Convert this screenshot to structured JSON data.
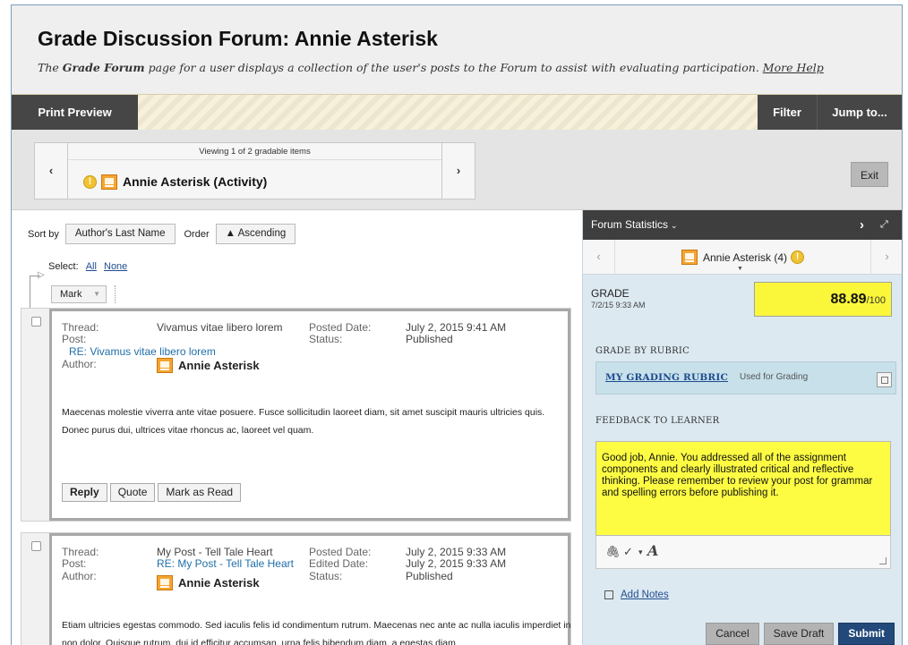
{
  "page": {
    "title": "Grade Discussion Forum: Annie Asterisk",
    "desc_pre": "The ",
    "desc_bold": "Grade Forum",
    "desc_post": " page for a user displays a collection of the user's posts to the Forum to assist with evaluating participation.",
    "more_help": "More Help"
  },
  "toolbar": {
    "print_preview": "Print Preview",
    "filter": "Filter",
    "jump_to": "Jump to..."
  },
  "pager": {
    "prev": "‹",
    "next": "›",
    "viewing": "Viewing 1 of 2 gradable items",
    "item_title": "Annie Asterisk (Activity)",
    "warn": "!",
    "exit": "Exit"
  },
  "sort": {
    "sort_by_label": "Sort by",
    "sort_by_value": "Author's Last Name",
    "order_label": "Order",
    "order_value": "▲ Ascending"
  },
  "select": {
    "label": "Select:",
    "all": "All",
    "none": "None",
    "mark": "Mark"
  },
  "posts": [
    {
      "thread_label": "Thread:",
      "thread_value": "Vivamus vitae libero lorem",
      "post_label": "Post:",
      "post_link": "RE: Vivamus vitae libero lorem",
      "author_label": "Author:",
      "author": "Annie Asterisk",
      "date1_label": "Posted Date:",
      "date1_value": "July 2, 2015 9:41 AM",
      "date2_label": "Status:",
      "date2_value": "Published",
      "body": "Maecenas molestie viverra ante vitae posuere. Fusce sollicitudin laoreet diam, sit amet suscipit mauris ultricies quis. Donec purus dui, ultrices vitae rhoncus ac, laoreet vel quam.",
      "reply": "Reply",
      "quote": "Quote",
      "mark_read": "Mark as Read"
    },
    {
      "thread_label": "Thread:",
      "thread_value": "My Post - Tell Tale Heart",
      "post_label": "Post:",
      "post_link": "RE: My Post - Tell Tale Heart",
      "author_label": "Author:",
      "author": "Annie Asterisk",
      "date1_label": "Posted Date:",
      "date1_value": "July 2, 2015 9:33 AM",
      "date2_label": "Edited Date:",
      "date2_value": "July 2, 2015 9:33 AM",
      "status_label": "Status:",
      "status_value": "Published",
      "body": "Etiam ultricies egestas commodo. Sed iaculis felis id condimentum rutrum. Maecenas nec ante ac nulla iaculis imperdiet in non dolor. Quisque rutrum, dui id efficitur accumsan, urna felis bibendum diam, a egestas diam"
    }
  ],
  "stats": {
    "title": "Forum Statistics",
    "dropdown": "⌄",
    "next": "›",
    "expand": "⤢",
    "user_prev": "‹",
    "user_next": "›",
    "user": "Annie Asterisk (4)"
  },
  "grade": {
    "label": "GRADE",
    "date": "7/2/15 9:33 AM",
    "value": "88.89",
    "out_of": "/100"
  },
  "rubric": {
    "section": "GRADE BY RUBRIC",
    "name": "MY GRADING RUBRIC",
    "used": "Used for Grading"
  },
  "feedback": {
    "section": "FEEDBACK TO LEARNER",
    "text": "Good job, Annie. You addressed all of the assignment components and clearly illustrated critical and reflective thinking. Please remember to review your post for grammar and spelling errors before publishing it."
  },
  "notes": {
    "add_notes": "Add Notes"
  },
  "actions": {
    "cancel": "Cancel",
    "save_draft": "Save Draft",
    "submit": "Submit"
  },
  "colors": {
    "toolbar_dark": "#464646",
    "grade_highlight": "#faf73a",
    "submit_blue": "#23497a",
    "panel_bg": "#dce9f1"
  }
}
